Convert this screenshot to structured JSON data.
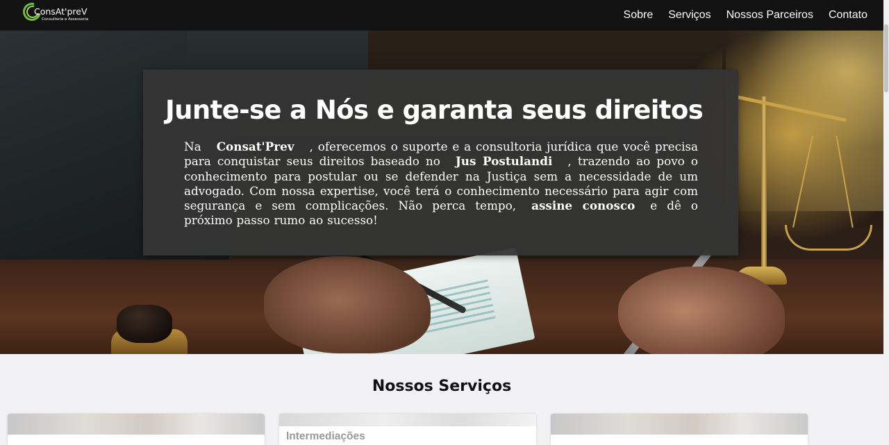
{
  "brand": {
    "name": "ConsAt'preV",
    "tagline": "Consultoria e Assessoria",
    "colors": {
      "ring_outer": "#6fbf3a",
      "ring_inner": "#a6d94f"
    }
  },
  "nav": {
    "items": [
      {
        "label": "Sobre"
      },
      {
        "label": "Serviços"
      },
      {
        "label": "Nossos Parceiros"
      },
      {
        "label": "Contato"
      }
    ]
  },
  "hero": {
    "title": "Junte-se a Nós e garanta seus direitos",
    "p1": "Na",
    "brand": "Consat'Prev",
    "p2": ", oferecemos o suporte e a consultoria jurídica que você precisa para conquistar seus direitos baseado no",
    "concept": "Jus Postulandi",
    "p3": ", trazendo ao povo o conhecimento para postular ou se defender na Justiça sem a necessidade de um advogado. Com nossa expertise, você terá o conhecimento necessário para agir com segurança e sem complicações. Não perca tempo,",
    "cta": "assine conosco",
    "p4": "e dê o próximo passo rumo ao sucesso!"
  },
  "services": {
    "title": "Nossos Serviços",
    "cards": [
      {
        "title": ""
      },
      {
        "title": "Intermediações"
      },
      {
        "title": ""
      }
    ]
  },
  "colors": {
    "navbar": "#121212",
    "hero_card": "#343434",
    "page_bg": "#f2f2f4"
  }
}
